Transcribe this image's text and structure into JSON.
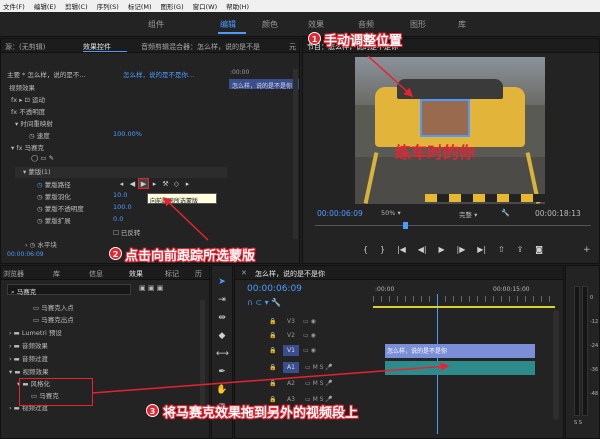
{
  "menu": [
    "文件(F)",
    "编辑(E)",
    "剪辑(C)",
    "序列(S)",
    "标记(M)",
    "图形(G)",
    "窗口(W)",
    "帮助(H)"
  ],
  "workspace_tabs": [
    "组件",
    "编辑",
    "颜色",
    "效果",
    "音频",
    "图形",
    "库"
  ],
  "effect_panel": {
    "tabs": [
      "源：(无剪辑)",
      "效果控件",
      "音频剪辑混合器：怎么样，说的是不是",
      "元"
    ],
    "clip_path": "主要 * 怎么样，说的是不...",
    "clip_right": "怎么样，说的是不是你...",
    "timecode_top": ":00:00",
    "timeline_label": "怎么样，说的是不是你",
    "video_effects": "视频效果",
    "motion": "运动",
    "opacity": "不透明度",
    "time_remap": "时间重映射",
    "speed": "速度",
    "speed_value": "100.00%",
    "mosaic": "马赛克",
    "mask_name": "蒙版(1)",
    "mask_path": "蒙版路径",
    "mask_feather": "蒙版羽化",
    "mask_feather_value": "10.0",
    "mask_opacity": "蒙版不透明度",
    "mask_opacity_value": "100.0",
    "mask_expand": "蒙版扩展",
    "mask_expand_value": "0.0",
    "inverted": "已反转",
    "horizontal_blocks": "水平块",
    "tooltip": "向前跟踪所选蒙版",
    "timecode": "00:00:06:09"
  },
  "program_monitor": {
    "title": "节目：怎么样，说的是不是你",
    "watermark": "练车时的你",
    "timecode": "00:00:06:09",
    "zoom": "50%",
    "quality": "完整",
    "duration": "00:00:18:13"
  },
  "effects_browser": {
    "tabs": [
      "浏览器",
      "库",
      "信息",
      "效果",
      "标记",
      "历"
    ],
    "search_value": "马赛克",
    "items": [
      "马赛克入点",
      "马赛克出点",
      "Lumetri 预设",
      "音频效果",
      "音频过渡",
      "视频效果",
      "风格化",
      "马赛克",
      "视频过渡"
    ]
  },
  "timeline": {
    "tab": "怎么样，说的是不是你",
    "timecode": "00:00:06:09",
    "ruler": [
      ":00:00",
      "00:00:15:00"
    ],
    "tracks": [
      "V3",
      "V2",
      "V1",
      "A1",
      "A2",
      "A3"
    ],
    "clip_label": "怎么样，说的是不是你"
  },
  "meter": {
    "labels": [
      "0",
      "-12",
      "-24",
      "-36",
      "-48",
      "S S"
    ]
  },
  "annotations": {
    "a1": {
      "num": "1",
      "text": "手动调整位置"
    },
    "a2": {
      "num": "2",
      "text": "点击向前跟踪所选蒙版"
    },
    "a3": {
      "num": "3",
      "text": "将马赛克效果拖到另外的视频段上"
    }
  },
  "colors": {
    "accent": "#4d9bff",
    "annotation": "#e8232f",
    "clip_blue": "#7a8fd8",
    "audio_clip": "#2e8b8b"
  }
}
